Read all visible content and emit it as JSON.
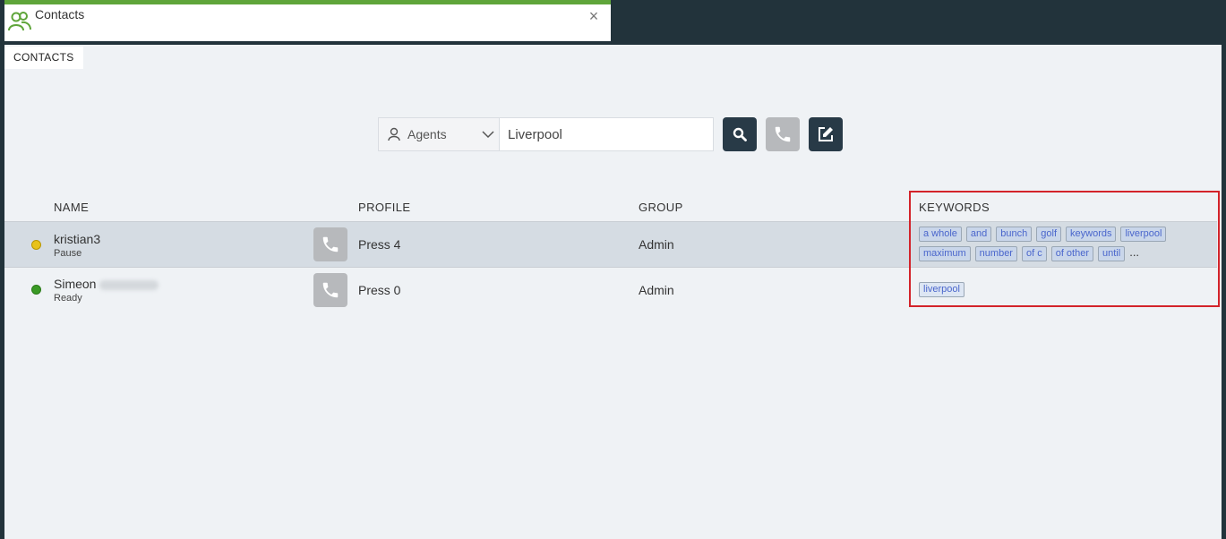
{
  "window": {
    "title": "Contacts",
    "close_label": "×"
  },
  "tabs": [
    {
      "label": "CONTACTS"
    }
  ],
  "search": {
    "type_label": "Agents",
    "query": "Liverpool"
  },
  "table": {
    "headers": {
      "name": "NAME",
      "profile": "PROFILE",
      "group": "GROUP",
      "keywords": "KEYWORDS"
    },
    "rows": [
      {
        "name": "kristian3",
        "status": "Pause",
        "status_color": "#e8c21a",
        "profile": "Press 4",
        "group": "Admin",
        "keywords": [
          "a whole",
          "and",
          "bunch",
          "golf",
          "keywords",
          "liverpool",
          "maximum",
          "number",
          "of c",
          "of other",
          "until"
        ],
        "more": "..."
      },
      {
        "name": "Simeon",
        "status": "Ready",
        "status_color": "#3a9a25",
        "profile": "Press 0",
        "group": "Admin",
        "keywords": [
          "liverpool"
        ]
      }
    ]
  },
  "colors": {
    "accent_green": "#5fa53a",
    "dark_button": "#283a47",
    "grey_button": "#b7b9bc",
    "highlight_red": "#d3232a"
  }
}
